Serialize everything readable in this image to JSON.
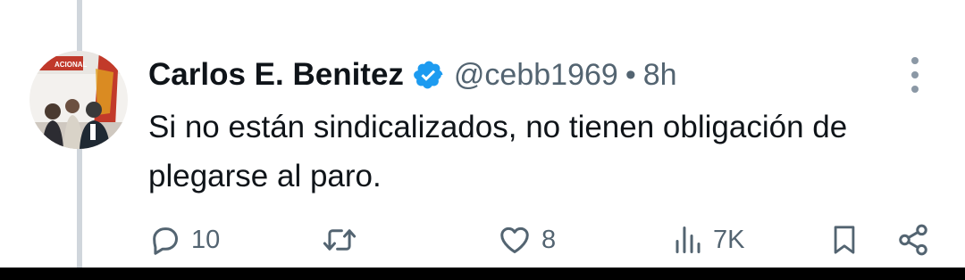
{
  "tweet": {
    "author_name": "Carlos E. Benitez",
    "handle": "@cebb1969",
    "separator": "•",
    "time": "8h",
    "verified": true,
    "text": "Si no están sindicalizados, no tienen obligación de plegarse al paro."
  },
  "actions": {
    "replies": "10",
    "reposts": "",
    "likes": "8",
    "views": "7K"
  },
  "avatar": {
    "banner_text": "ACIONAL"
  },
  "colors": {
    "text_primary": "#0f1419",
    "text_secondary": "#536471",
    "verified_blue": "#1d9bf0",
    "thread_line": "#d0d6dc"
  }
}
